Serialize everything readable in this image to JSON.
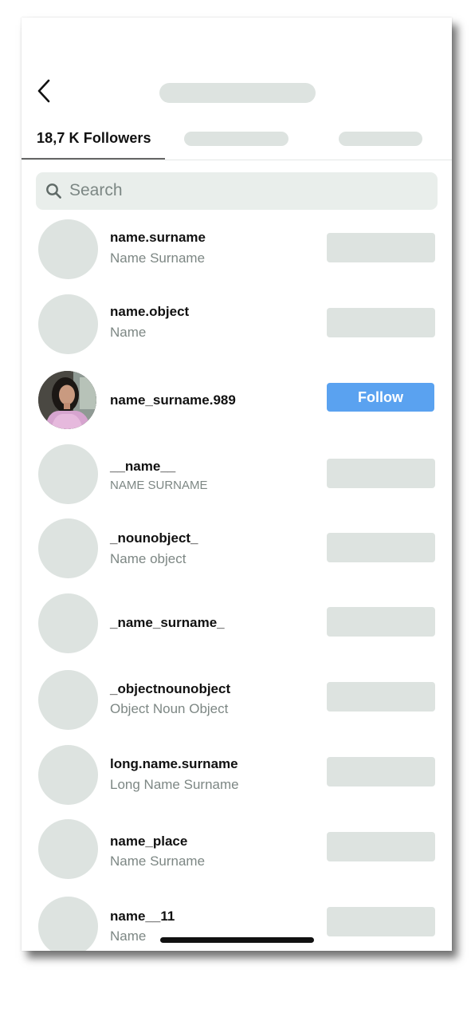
{
  "header": {
    "back_icon": "chevron-left-icon"
  },
  "tabs": {
    "active_label": "18,7 K Followers"
  },
  "search": {
    "icon": "search-icon",
    "placeholder": "Search"
  },
  "colors": {
    "accent": "#5aa2f0",
    "placeholder_gray": "#dde3e0",
    "secondary_text": "#7d8784"
  },
  "followers": [
    {
      "username": "name.surname",
      "fullname": "Name Surname"
    },
    {
      "username": "name.object",
      "fullname": "Name"
    },
    {
      "username": "name_surname.989",
      "fullname": "",
      "has_photo": true,
      "button_label": "Follow"
    },
    {
      "username": "__name__",
      "fullname": "NAME SURNAME"
    },
    {
      "username": "_nounobject_",
      "fullname": "Name object"
    },
    {
      "username": "_name_surname_",
      "fullname": ""
    },
    {
      "username": "_objectnounobject",
      "fullname": "Object Noun Object"
    },
    {
      "username": "long.name.surname",
      "fullname": "Long Name Surname"
    },
    {
      "username": "name_place",
      "fullname": "Name Surname"
    },
    {
      "username": "name__11",
      "fullname": "Name"
    }
  ]
}
